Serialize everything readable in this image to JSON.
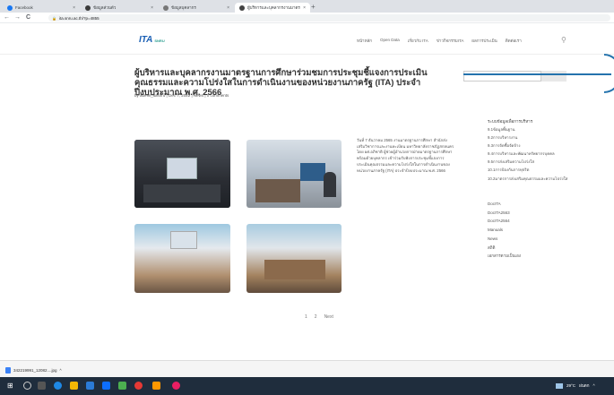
{
  "browser": {
    "tabs": [
      {
        "title": "Facebook",
        "color": "#1877f2",
        "active": false
      },
      {
        "title": "ข้อมูลส่วนตัว",
        "color": "#3b3b3b",
        "active": false
      },
      {
        "title": "ข้อมูลบุคลากร",
        "color": "#555555",
        "active": false
      },
      {
        "title": "ผู้บริหารและบุคลากรงานมาตรฐานการศึ",
        "color": "#444444",
        "active": true
      }
    ],
    "new_tab": "+",
    "url": "ita.snru.ac.th/?p=4855",
    "back": "←",
    "forward": "→",
    "reload": "C"
  },
  "site": {
    "logo": "ITA",
    "logo_sub": "SNRU",
    "menu": [
      "หน้าหลัก",
      "Open Data",
      "เกี่ยวกับ ITA",
      "ข่าวกิจกรรมITA",
      "ผลการประเมิน",
      "ติดต่อเรา"
    ],
    "search_icon": "search-icon"
  },
  "article": {
    "title": "ผู้บริหารและบุคลากรงานมาตรฐานการศึกษาร่วมชมการประชุมชี้แจงการประเมินคุณธรรมและความโปร่งใสในการดำเนินงานของหน่วยงานภาครัฐ (ITA) ประจำปีงบประมาณ พ.ศ. 2566",
    "meta": "by admin_itasnru | Dec 7, 2022 | News | 0 comments",
    "body": "วันที่ 7 ธันวาคม 2565 งานมาตรฐานการศึกษา สำนักส่งเสริมวิชาการและงานทะเบียน มหาวิทยาลัยราชภัฏสกลนคร โดย ผศ.อภิชาติ ผู้ช่วยผู้อำนวยการฝ่ายมาตรฐานการศึกษา พร้อมด้วยบุคลากร เข้าร่วมรับฟังการประชุมชี้แจงการประเมินคุณธรรมและความโปร่งใสในการดำเนินงานของหน่วยงานภาครัฐ (ITA) ประจำปีงบประมาณ พ.ศ. 2566",
    "pager": [
      "1",
      "2",
      "Next"
    ]
  },
  "sidebar": {
    "heading": "ระบบข้อมูลเพื่อการบริหาร",
    "links": [
      "9.1ข้อมูลพื้นฐาน",
      "9.2การบริหารงาน",
      "9.3การจัดซื้อจัดจ้าง",
      "9.4การบริหารและพัฒนาทรัพยากรบุคคล",
      "9.5การส่งเสริมความโปร่งใส",
      "10.1การป้องกันการทุจริต",
      "10.2มาตรการส่งเสริมคุณธรรมและความโปร่งใส"
    ],
    "categories": [
      "DocITA",
      "DocITA2563",
      "DocITA2564",
      "Manuals",
      "News",
      "สถิติ",
      "เอกสารตามเป็นเอง"
    ]
  },
  "downloads": {
    "file": "342219991_12082....jpg",
    "chevron": "^"
  },
  "taskbar": {
    "weather": "29°C",
    "lang": "ฝนตก",
    "chevron": "^"
  }
}
